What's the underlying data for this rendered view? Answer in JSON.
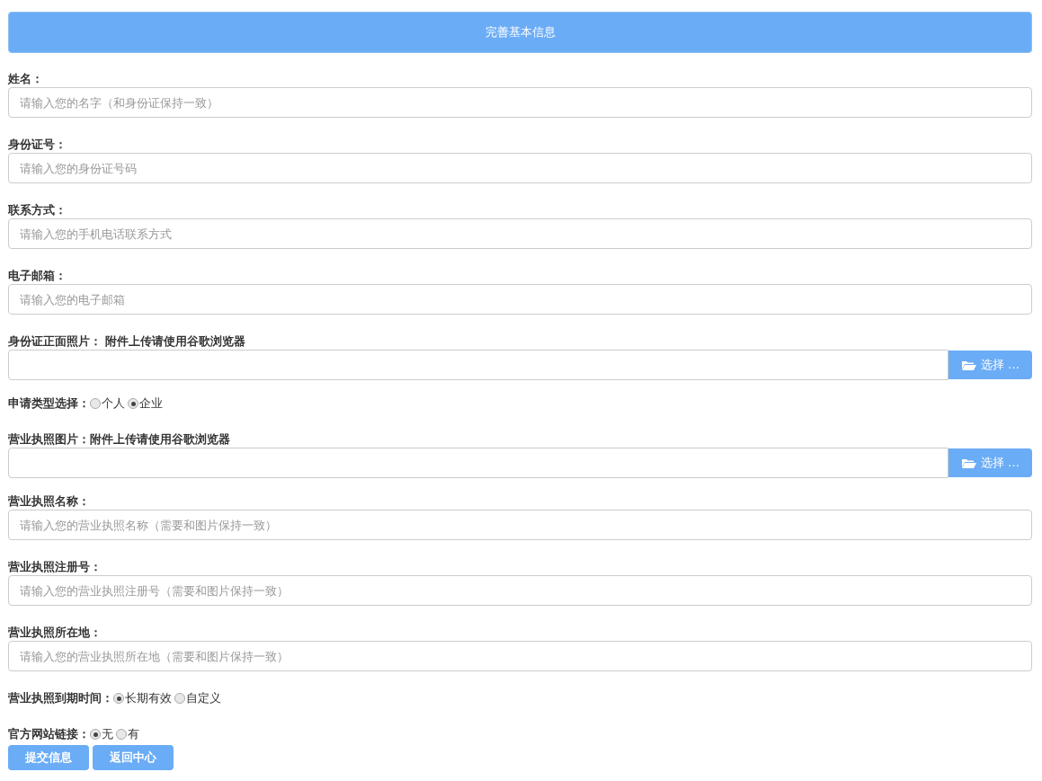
{
  "header": {
    "title": "完善基本信息"
  },
  "fields": [
    {
      "kind": "text",
      "label": "姓名：",
      "placeholder": "请输入您的名字（和身份证保持一致）"
    },
    {
      "kind": "text",
      "label": "身份证号：",
      "placeholder": "请输入您的身份证号码"
    },
    {
      "kind": "text",
      "label": "联系方式：",
      "placeholder": "请输入您的手机电话联系方式"
    },
    {
      "kind": "text",
      "label": "电子邮箱：",
      "placeholder": "请输入您的电子邮箱"
    },
    {
      "kind": "file",
      "label": "身份证正面照片： 附件上传请使用谷歌浏览器",
      "button": "选择 …"
    },
    {
      "kind": "radio",
      "label": "申请类型选择：",
      "options": [
        {
          "label": "个人",
          "selected": false
        },
        {
          "label": "企业",
          "selected": true
        }
      ]
    },
    {
      "kind": "file",
      "label": "营业执照图片：附件上传请使用谷歌浏览器",
      "button": "选择 …"
    },
    {
      "kind": "text",
      "label": "营业执照名称：",
      "placeholder": "请输入您的营业执照名称（需要和图片保持一致）"
    },
    {
      "kind": "text",
      "label": "营业执照注册号：",
      "placeholder": "请输入您的营业执照注册号（需要和图片保持一致）"
    },
    {
      "kind": "text",
      "label": "营业执照所在地：",
      "placeholder": "请输入您的营业执照所在地（需要和图片保持一致）"
    },
    {
      "kind": "radio",
      "label": "营业执照到期时间：",
      "options": [
        {
          "label": "长期有效",
          "selected": true
        },
        {
          "label": "自定义",
          "selected": false
        }
      ]
    },
    {
      "kind": "radio",
      "label": "官方网站链接：",
      "options": [
        {
          "label": "无",
          "selected": true
        },
        {
          "label": "有",
          "selected": false
        }
      ]
    }
  ],
  "buttons": [
    "提交信息",
    "返回中心"
  ]
}
